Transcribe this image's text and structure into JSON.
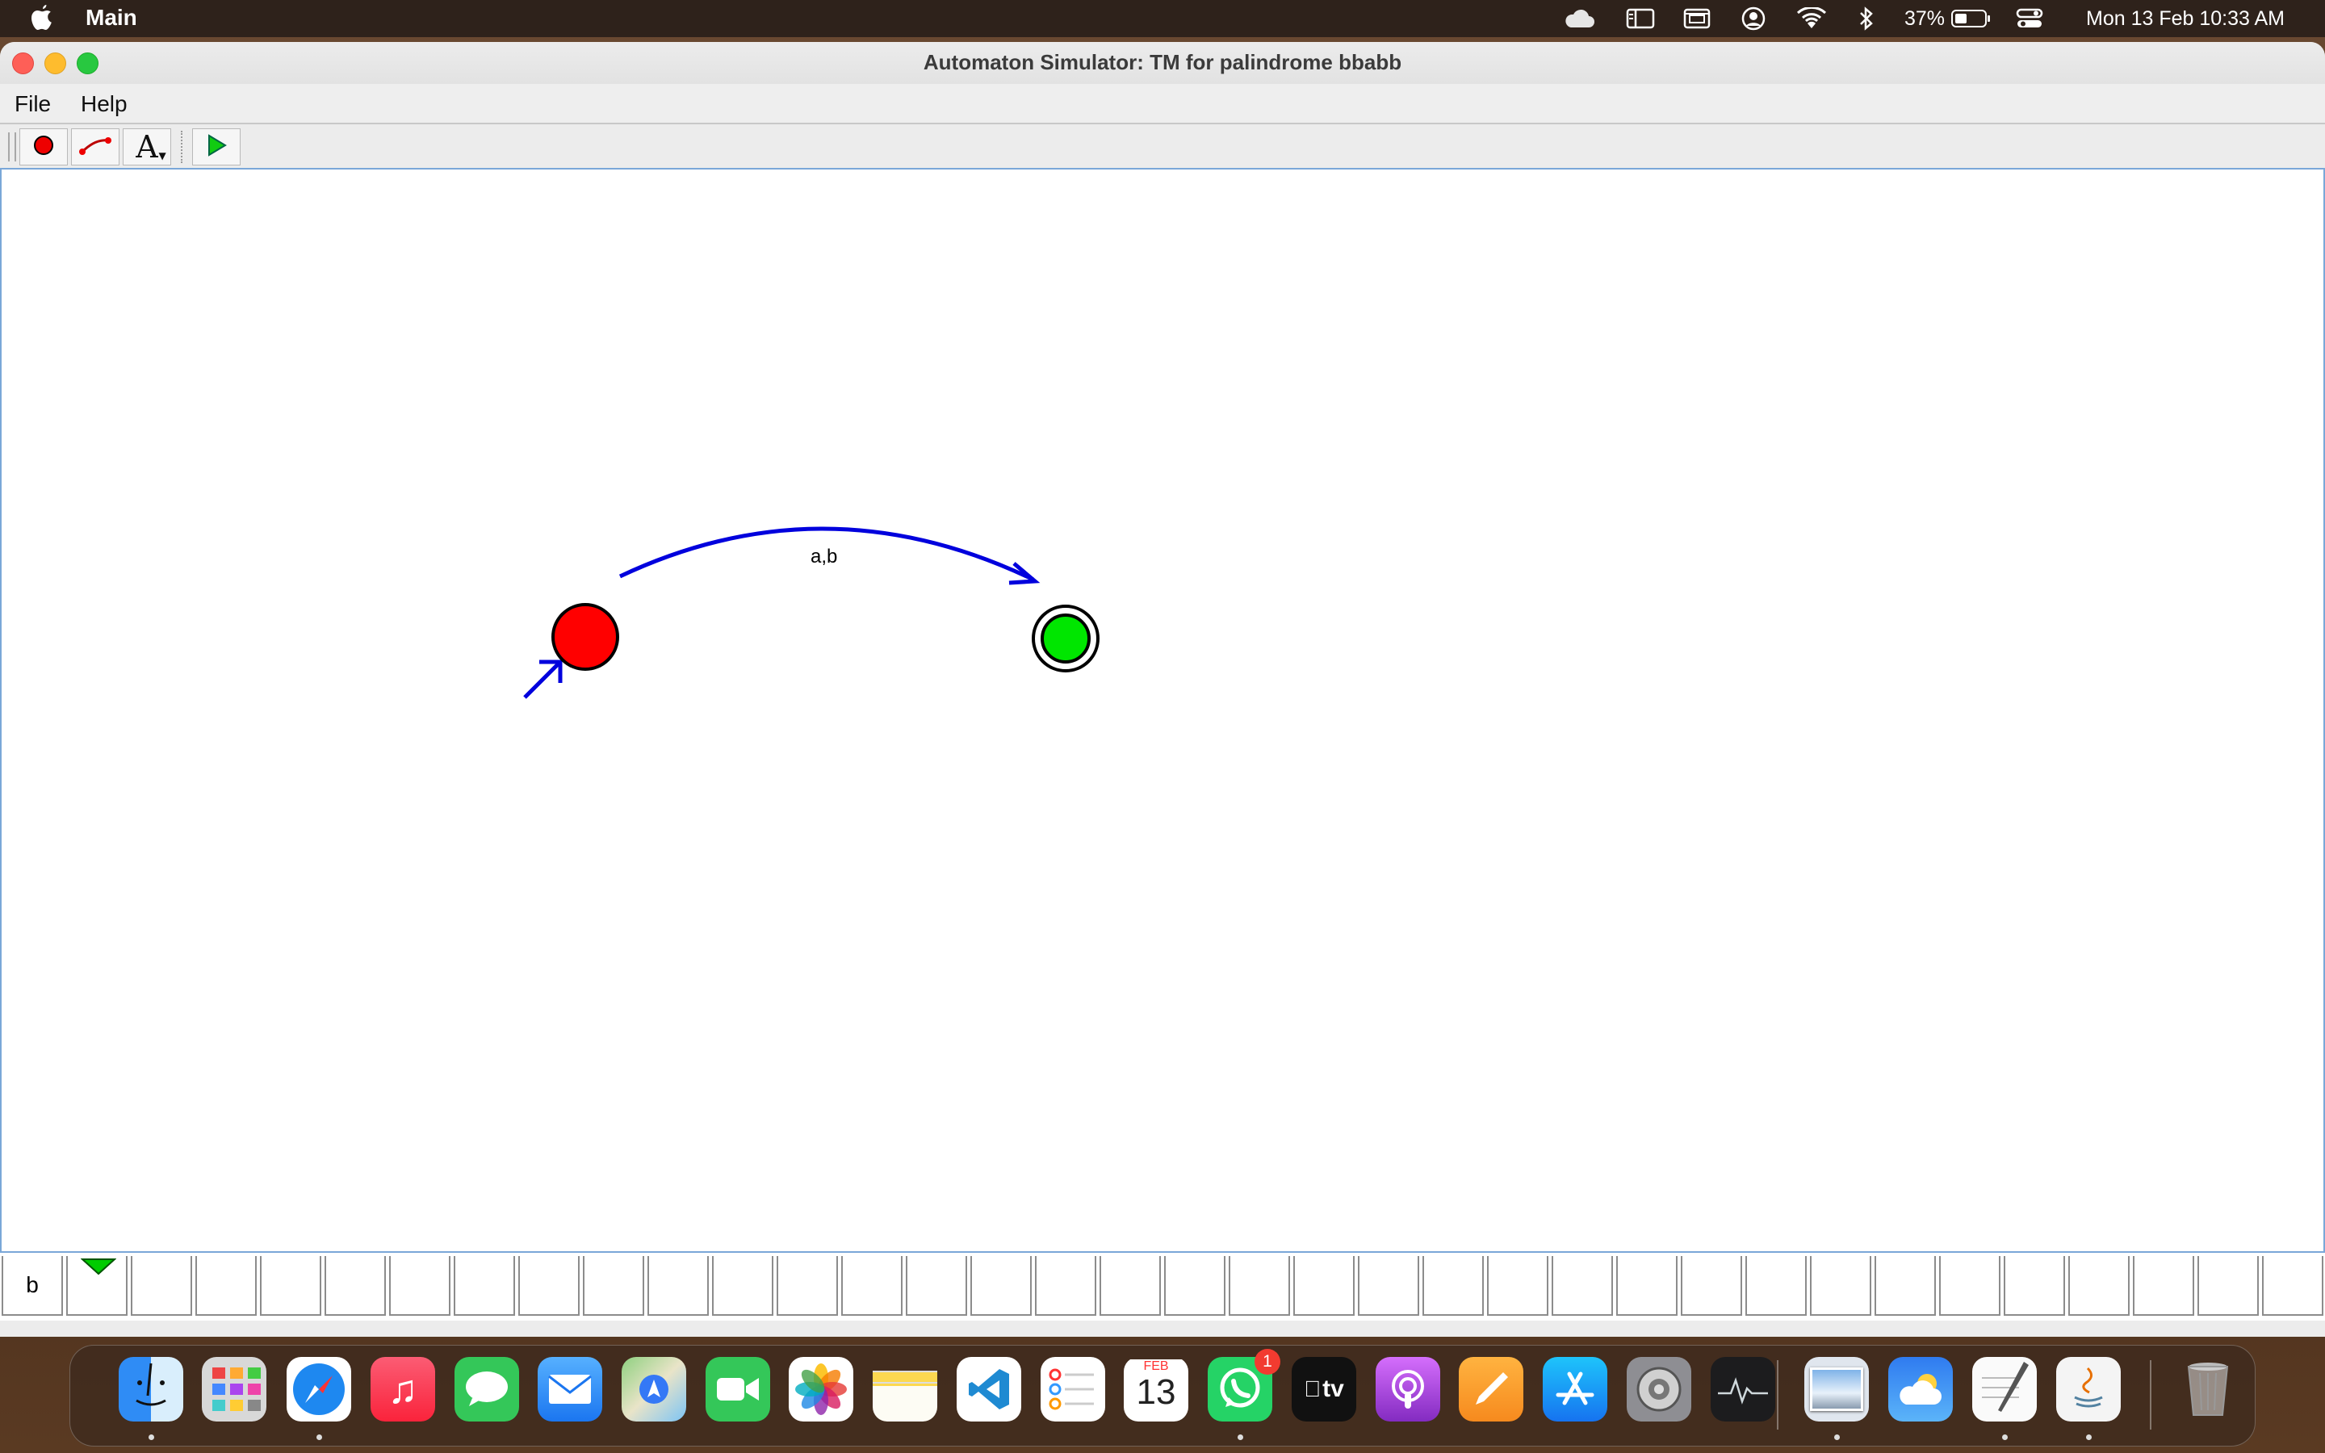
{
  "system_menubar": {
    "app_name": "Main",
    "battery_percent": "37%",
    "datetime": "Mon 13 Feb  10:33 AM"
  },
  "window": {
    "title": "Automaton Simulator: TM for palindrome bbabb",
    "menu": {
      "file": "File",
      "help": "Help"
    }
  },
  "toolbar": {
    "tools": [
      {
        "icon": "add-state-icon"
      },
      {
        "icon": "add-transition-icon"
      },
      {
        "icon": "text-tool-icon",
        "glyph": "A"
      },
      {
        "icon": "play-icon"
      }
    ]
  },
  "automaton": {
    "states": [
      {
        "id": "start",
        "kind": "initial",
        "color": "#ff0000"
      },
      {
        "id": "accept",
        "kind": "accepting",
        "color": "#00e600"
      }
    ],
    "transitions": [
      {
        "from": "start",
        "to": "accept",
        "label": "a,b",
        "color": "#0000dd"
      }
    ]
  },
  "tape": {
    "cells": [
      "b",
      "",
      "",
      "",
      "",
      "",
      "",
      "",
      "",
      "",
      "",
      "",
      "",
      "",
      "",
      "",
      "",
      "",
      "",
      "",
      "",
      "",
      "",
      "",
      "",
      "",
      "",
      "",
      "",
      "",
      "",
      "",
      "",
      "",
      "",
      ""
    ],
    "head_index": 1,
    "head_color": "#00cc00"
  },
  "dock": {
    "apps": [
      {
        "name": "Finder",
        "icon": "finder-icon"
      },
      {
        "name": "Launchpad",
        "icon": "launchpad-icon"
      },
      {
        "name": "Safari",
        "icon": "safari-icon"
      },
      {
        "name": "Music",
        "icon": "music-icon"
      },
      {
        "name": "Messages",
        "icon": "messages-icon"
      },
      {
        "name": "Mail",
        "icon": "mail-icon"
      },
      {
        "name": "Maps",
        "icon": "maps-icon"
      },
      {
        "name": "FaceTime",
        "icon": "facetime-icon"
      },
      {
        "name": "Photos",
        "icon": "photos-icon"
      },
      {
        "name": "Notes",
        "icon": "notes-icon"
      },
      {
        "name": "Visual Studio Code",
        "icon": "vscode-icon"
      },
      {
        "name": "Reminders",
        "icon": "reminders-icon"
      },
      {
        "name": "Calendar",
        "icon": "calendar-icon",
        "month": "FEB",
        "day": "13"
      },
      {
        "name": "WhatsApp",
        "icon": "whatsapp-icon",
        "badge": "1"
      },
      {
        "name": "Apple TV",
        "icon": "appletv-icon",
        "label": "tv"
      },
      {
        "name": "Podcasts",
        "icon": "podcasts-icon"
      },
      {
        "name": "Pages",
        "icon": "pages-icon"
      },
      {
        "name": "App Store",
        "icon": "appstore-icon"
      },
      {
        "name": "System Settings",
        "icon": "settings-icon"
      },
      {
        "name": "Activity Monitor",
        "icon": "activity-monitor-icon"
      },
      {
        "name": "Preview",
        "icon": "preview-icon"
      },
      {
        "name": "Weather",
        "icon": "weather-icon"
      },
      {
        "name": "TextEdit",
        "icon": "textedit-icon"
      },
      {
        "name": "Java",
        "icon": "java-icon"
      },
      {
        "name": "Trash",
        "icon": "trash-icon"
      }
    ]
  }
}
